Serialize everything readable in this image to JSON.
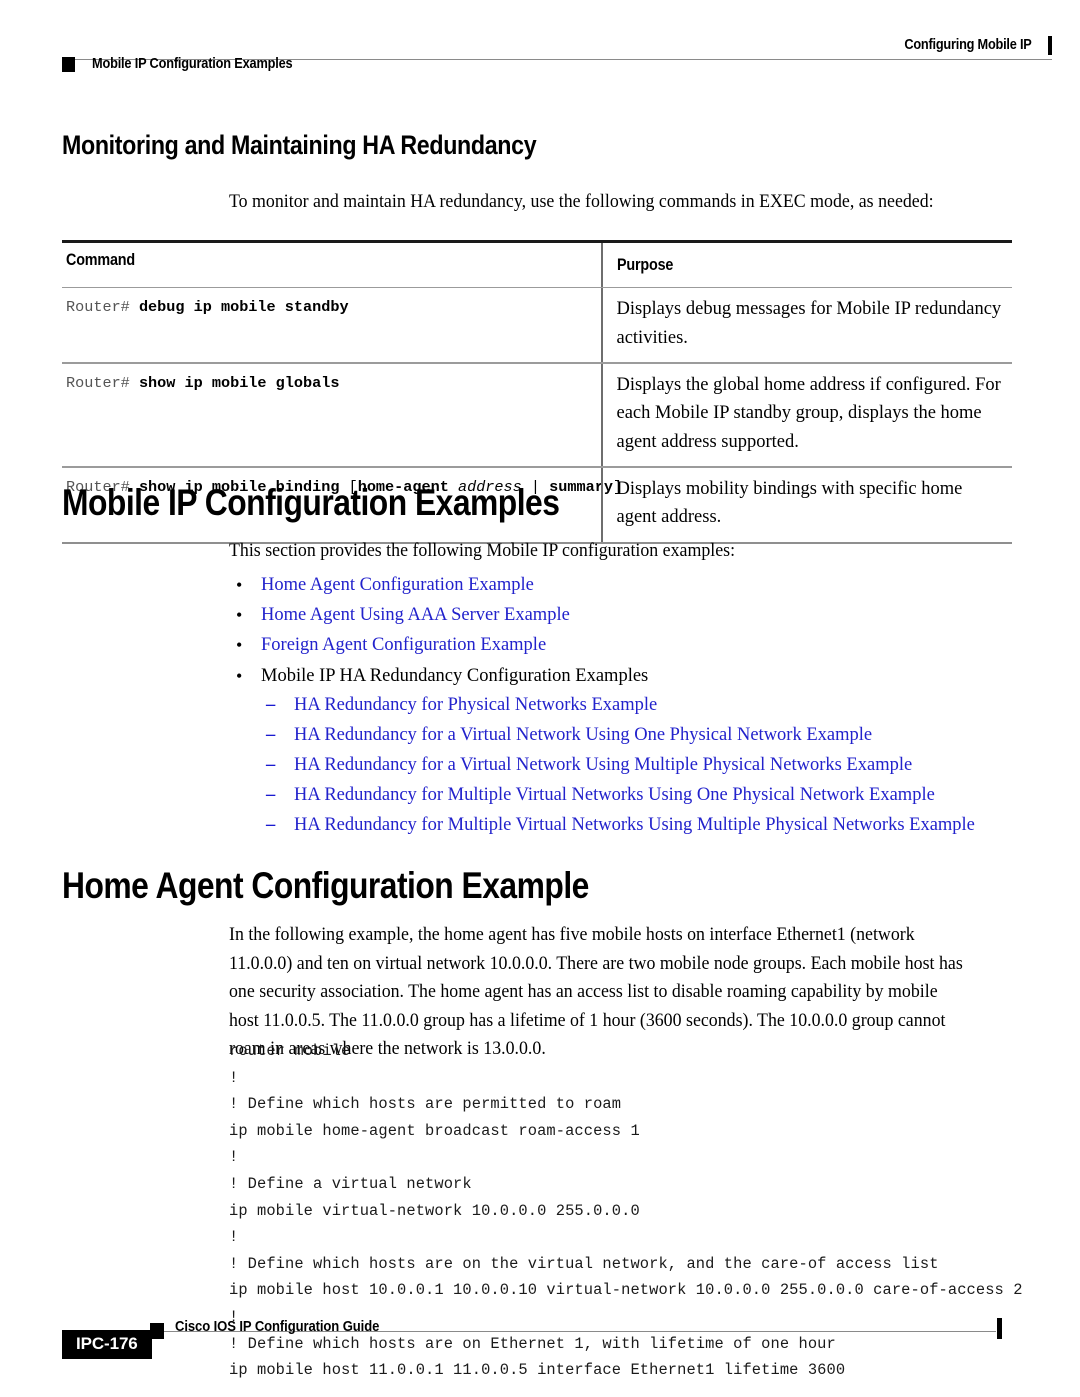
{
  "header": {
    "running_title": "Configuring Mobile IP",
    "section_name": "Mobile IP Configuration Examples"
  },
  "sections": {
    "monitoring": {
      "heading": "Monitoring and Maintaining HA Redundancy",
      "intro": "To monitor and maintain HA redundancy, use the following commands in EXEC mode, as needed:"
    },
    "examples": {
      "heading": "Mobile IP Configuration Examples",
      "intro": "This section provides the following Mobile IP configuration examples:"
    },
    "home_agent": {
      "heading": "Home Agent Configuration Example",
      "paragraph": "In the following example, the home agent has five mobile hosts on interface Ethernet1 (network 11.0.0.0) and ten on virtual network 10.0.0.0. There are two mobile node groups. Each mobile host has one security association. The home agent has an access list to disable roaming capability by mobile host 11.0.0.5. The 11.0.0.0 group has a lifetime of 1 hour (3600 seconds). The 10.0.0.0 group cannot roam in areas where the network is 13.0.0.0."
    }
  },
  "command_table": {
    "headers": {
      "command": "Command",
      "purpose": "Purpose"
    },
    "rows": [
      {
        "prompt": "Router#",
        "cmd_bold_1": "debug ip mobile standby",
        "purpose": "Displays debug messages for Mobile IP redundancy activities."
      },
      {
        "prompt": "Router#",
        "cmd_bold_1": "show ip mobile globals",
        "purpose": "Displays the global home address if configured. For each Mobile IP standby group, displays the home agent address supported."
      },
      {
        "prompt": "Router#",
        "cmd_bold_1": "show ip mobile binding",
        "cmd_open_bracket": "[",
        "cmd_bold_2": "home-agent",
        "cmd_italic": "address",
        "cmd_pipe": "|",
        "cmd_bold_3": "summary",
        "cmd_close_bracket": "]",
        "purpose": "Displays mobility bindings with specific home agent address."
      }
    ]
  },
  "example_links": {
    "bullets": [
      {
        "label": "Home Agent Configuration Example",
        "is_link": true
      },
      {
        "label": "Home Agent Using AAA Server Example",
        "is_link": true
      },
      {
        "label": "Foreign Agent Configuration Example",
        "is_link": true
      },
      {
        "label": "Mobile IP HA Redundancy Configuration Examples",
        "is_link": false
      }
    ],
    "sub_bullets": [
      {
        "label": "HA Redundancy for Physical Networks Example",
        "is_link": true
      },
      {
        "label": "HA Redundancy for a Virtual Network Using One Physical Network Example",
        "is_link": true
      },
      {
        "label": "HA Redundancy for a Virtual Network Using Multiple Physical Networks Example",
        "is_link": true
      },
      {
        "label": "HA Redundancy for Multiple Virtual Networks Using One Physical Network Example",
        "is_link": true
      },
      {
        "label": "HA Redundancy for Multiple Virtual Networks Using Multiple Physical Networks Example",
        "is_link": true
      }
    ]
  },
  "code_example": "router mobile\n!\n! Define which hosts are permitted to roam\nip mobile home-agent broadcast roam-access 1\n!\n! Define a virtual network\nip mobile virtual-network 10.0.0.0 255.0.0.0\n!\n! Define which hosts are on the virtual network, and the care-of access list\nip mobile host 10.0.0.1 10.0.0.10 virtual-network 10.0.0.0 255.0.0.0 care-of-access 2\n!\n! Define which hosts are on Ethernet 1, with lifetime of one hour\nip mobile host 11.0.0.1 11.0.0.5 interface Ethernet1 lifetime 3600",
  "footer": {
    "guide_title": "Cisco IOS IP Configuration Guide",
    "page_number": "IPC-176"
  },
  "colors": {
    "link_blue": "#2222cc",
    "text_black": "#000000",
    "rule_gray": "#8a8a8a"
  }
}
